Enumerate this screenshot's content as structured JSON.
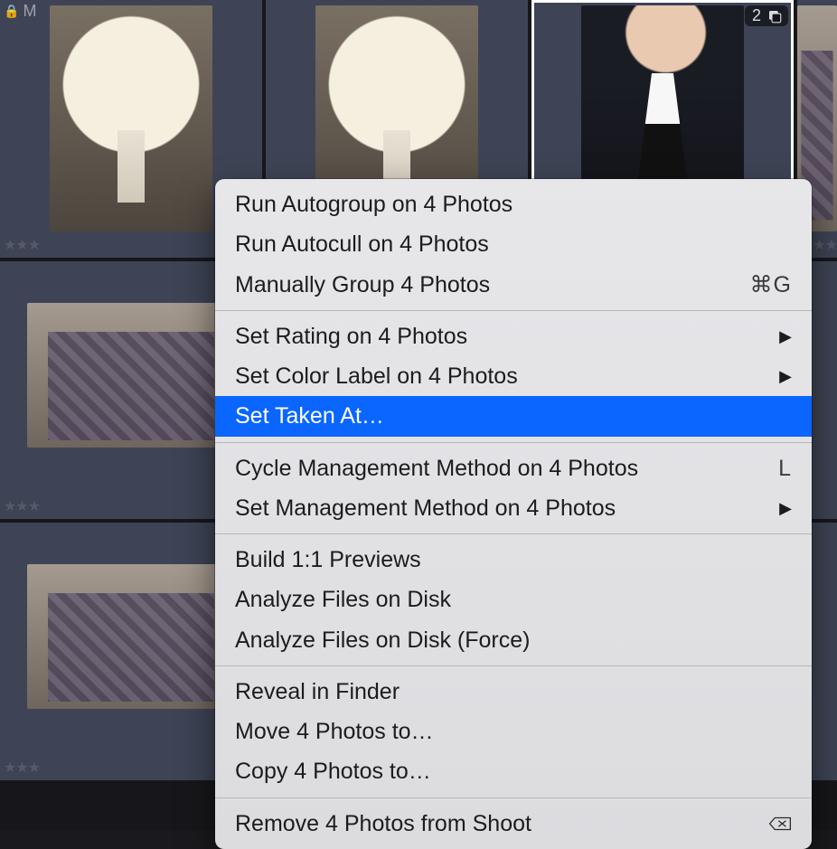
{
  "grid": {
    "rows": [
      [
        {
          "kind": "bouquet",
          "rating": 3,
          "locked": true,
          "m_flag": "M",
          "selected": false
        },
        {
          "kind": "bouquet",
          "rating": 0,
          "selected": false
        },
        {
          "kind": "groom",
          "rating": 0,
          "selected": true,
          "stack_count": "2"
        },
        {
          "kind": "plaid",
          "rating": 3,
          "selected": false,
          "partial": true
        }
      ],
      [
        {
          "kind": "plaid",
          "shape": "square",
          "rating": 3,
          "selected": false
        },
        {
          "kind": "hidden"
        },
        {
          "kind": "hidden"
        },
        {
          "kind": "hidden"
        }
      ],
      [
        {
          "kind": "plaid",
          "shape": "square",
          "rating": 3,
          "selected": false
        },
        {
          "kind": "hidden"
        },
        {
          "kind": "hidden"
        },
        {
          "kind": "hidden"
        }
      ]
    ]
  },
  "menu": {
    "groups": [
      [
        {
          "label": "Run Autogroup on 4 Photos"
        },
        {
          "label": "Run Autocull on 4 Photos"
        },
        {
          "label": "Manually Group 4 Photos",
          "accel": "⌘G"
        }
      ],
      [
        {
          "label": "Set Rating on 4 Photos",
          "submenu": true
        },
        {
          "label": "Set Color Label on 4 Photos",
          "submenu": true
        },
        {
          "label": "Set Taken At…",
          "highlight": true
        }
      ],
      [
        {
          "label": "Cycle Management Method on 4 Photos",
          "accel": "L"
        },
        {
          "label": "Set Management Method on 4 Photos",
          "submenu": true
        }
      ],
      [
        {
          "label": "Build 1:1 Previews"
        },
        {
          "label": "Analyze Files on Disk"
        },
        {
          "label": "Analyze Files on Disk (Force)"
        }
      ],
      [
        {
          "label": "Reveal in Finder"
        },
        {
          "label": "Move 4 Photos to…"
        },
        {
          "label": "Copy 4 Photos to…"
        }
      ],
      [
        {
          "label": "Remove 4 Photos from Shoot",
          "delete_icon": true
        }
      ]
    ]
  }
}
